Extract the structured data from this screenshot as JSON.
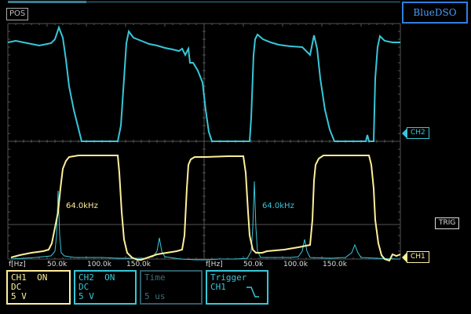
{
  "header": {
    "pos_label": "POS",
    "brand": "BlueDSO"
  },
  "markers": {
    "ch2": "CH2",
    "ch1": "CH1",
    "trig": "TRIG"
  },
  "fft": {
    "axis_label": "f[Hz]",
    "ticks": [
      "50.0k",
      "100.0k",
      "150.0k"
    ],
    "peak_ch1": "64.0kHz",
    "peak_ch2": "64.0kHz"
  },
  "panels": {
    "ch1": {
      "title": "CH1  ON",
      "coupling": "DC",
      "scale": "5 V"
    },
    "ch2": {
      "title": "CH2  ON",
      "coupling": "DC",
      "scale": "5 V"
    },
    "time": {
      "title": "Time",
      "value": "5 us"
    },
    "trigger": {
      "title": "Trigger",
      "source": "CH1"
    }
  },
  "colors": {
    "ch1": "#ffef9a",
    "ch2": "#37c7d9",
    "grid": "#555555"
  }
}
